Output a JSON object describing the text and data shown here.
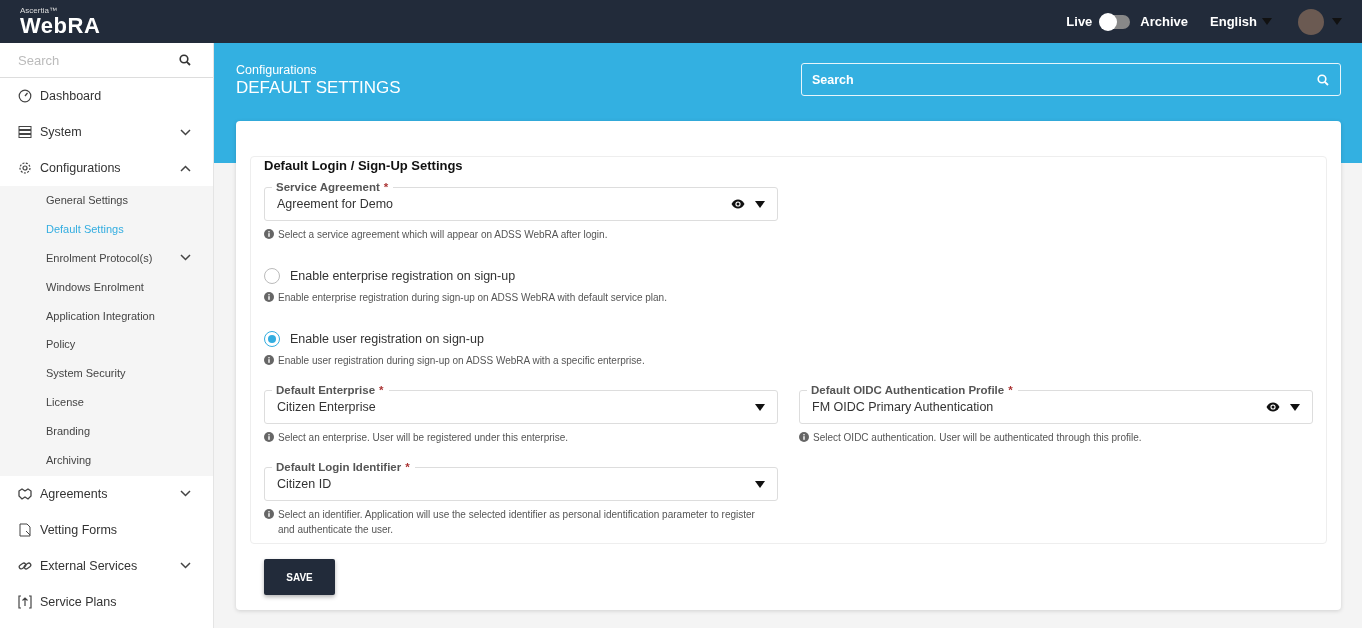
{
  "topbar": {
    "vendor": "Ascertia™",
    "brand": "WebRA",
    "live_label": "Live",
    "archive_label": "Archive",
    "archive_on": false,
    "language": "English"
  },
  "sidebar": {
    "search_placeholder": "Search",
    "items": [
      {
        "label": "Dashboard",
        "selected": false
      },
      {
        "label": "System",
        "selected": false,
        "expanded": false
      },
      {
        "label": "Configurations",
        "selected": false,
        "expanded": true,
        "children": [
          {
            "label": "General Settings",
            "selected": false
          },
          {
            "label": "Default Settings",
            "selected": true
          },
          {
            "label": "Enrolment Protocol(s)",
            "selected": false,
            "expanded": false
          },
          {
            "label": "Windows Enrolment",
            "selected": false
          },
          {
            "label": "Application Integration",
            "selected": false
          },
          {
            "label": "Policy",
            "selected": false
          },
          {
            "label": "System Security",
            "selected": false
          },
          {
            "label": "License",
            "selected": false
          },
          {
            "label": "Branding",
            "selected": false
          },
          {
            "label": "Archiving",
            "selected": false
          }
        ]
      },
      {
        "label": "Agreements",
        "selected": false,
        "expanded": false
      },
      {
        "label": "Vetting Forms",
        "selected": false
      },
      {
        "label": "External Services",
        "selected": false,
        "expanded": false
      },
      {
        "label": "Service Plans",
        "selected": false
      }
    ]
  },
  "page_header": {
    "breadcrumb": "Configurations",
    "title": "DEFAULT SETTINGS",
    "search_placeholder": "Search"
  },
  "form": {
    "title": "Default Login / Sign-Up Settings",
    "rows": [
      [
        {
          "kind": "select",
          "label": "Service Agreement",
          "required_mark": "*",
          "value": "Agreement for Demo",
          "preview": true,
          "hint": "Select a service agreement which will appear on ADSS WebRA after login."
        }
      ],
      [
        {
          "kind": "radio",
          "label": "Enable enterprise registration on sign-up",
          "selected": false,
          "hint": "Enable enterprise registration during sign-up on ADSS WebRA with default service plan."
        }
      ],
      [
        {
          "kind": "radio",
          "label": "Enable user registration on sign-up",
          "selected": true,
          "hint": "Enable user registration during sign-up on ADSS WebRA with a specific enterprise."
        }
      ],
      [
        {
          "kind": "select",
          "label": "Default Enterprise",
          "required_mark": "*",
          "value": "Citizen Enterprise",
          "preview": false,
          "hint": "Select an enterprise. User will be registered under this enterprise."
        },
        {
          "kind": "select",
          "label": "Default OIDC Authentication Profile",
          "required_mark": "*",
          "value": "FM OIDC Primary Authentication",
          "preview": true,
          "hint": "Select OIDC authentication. User will be authenticated through this profile."
        }
      ],
      [
        {
          "kind": "select",
          "label": "Default Login Identifier",
          "required_mark": "*",
          "value": "Citizen ID",
          "preview": false,
          "hint": "Select an identifier. Application will use the selected identifier as personal identification parameter to register and authenticate the user."
        }
      ]
    ],
    "save_button": "SAVE"
  }
}
